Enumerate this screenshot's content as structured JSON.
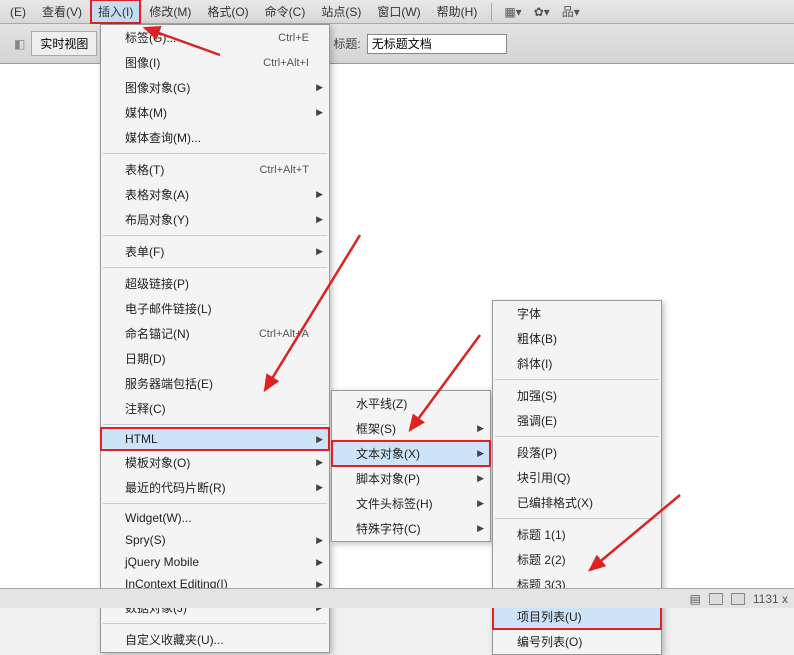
{
  "menubar": {
    "items": [
      {
        "label": "(E)"
      },
      {
        "label": "查看(V)"
      },
      {
        "label": "插入(I)"
      },
      {
        "label": "修改(M)"
      },
      {
        "label": "格式(O)"
      },
      {
        "label": "命令(C)"
      },
      {
        "label": "站点(S)"
      },
      {
        "label": "窗口(W)"
      },
      {
        "label": "帮助(H)"
      }
    ]
  },
  "toolbar": {
    "realtime_btn": "实时视图",
    "title_label": "标题:",
    "title_value": "无标题文档"
  },
  "menu1": {
    "items": [
      {
        "label": "标签(G)...",
        "shortcut": "Ctrl+E"
      },
      {
        "label": "图像(I)",
        "shortcut": "Ctrl+Alt+I"
      },
      {
        "label": "图像对象(G)",
        "arrow": true
      },
      {
        "label": "媒体(M)",
        "arrow": true
      },
      {
        "label": "媒体查询(M)..."
      },
      {
        "sep": true
      },
      {
        "label": "表格(T)",
        "shortcut": "Ctrl+Alt+T"
      },
      {
        "label": "表格对象(A)",
        "arrow": true
      },
      {
        "label": "布局对象(Y)",
        "arrow": true
      },
      {
        "sep": true
      },
      {
        "label": "表单(F)",
        "arrow": true
      },
      {
        "sep": true
      },
      {
        "label": "超级链接(P)"
      },
      {
        "label": "电子邮件链接(L)"
      },
      {
        "label": "命名锚记(N)",
        "shortcut": "Ctrl+Alt+A"
      },
      {
        "label": "日期(D)"
      },
      {
        "label": "服务器端包括(E)"
      },
      {
        "label": "注释(C)"
      },
      {
        "sep": true
      },
      {
        "label": "HTML",
        "arrow": true,
        "redbox": true,
        "hl": true
      },
      {
        "label": "模板对象(O)",
        "arrow": true
      },
      {
        "label": "最近的代码片断(R)",
        "arrow": true
      },
      {
        "sep": true
      },
      {
        "label": "Widget(W)..."
      },
      {
        "label": "Spry(S)",
        "arrow": true
      },
      {
        "label": "jQuery Mobile",
        "arrow": true
      },
      {
        "label": "InContext Editing(I)",
        "arrow": true
      },
      {
        "label": "数据对象(J)",
        "arrow": true
      },
      {
        "sep": true
      },
      {
        "label": "自定义收藏夹(U)..."
      }
    ]
  },
  "menu2": {
    "items": [
      {
        "label": "水平线(Z)"
      },
      {
        "label": "框架(S)",
        "arrow": true
      },
      {
        "label": "文本对象(X)",
        "arrow": true,
        "redbox": true,
        "hl": true
      },
      {
        "label": "脚本对象(P)",
        "arrow": true
      },
      {
        "label": "文件头标签(H)",
        "arrow": true
      },
      {
        "label": "特殊字符(C)",
        "arrow": true
      }
    ]
  },
  "menu3": {
    "items": [
      {
        "label": "字体"
      },
      {
        "label": "粗体(B)"
      },
      {
        "label": "斜体(I)"
      },
      {
        "sep": true
      },
      {
        "label": "加强(S)"
      },
      {
        "label": "强调(E)"
      },
      {
        "sep": true
      },
      {
        "label": "段落(P)"
      },
      {
        "label": "块引用(Q)"
      },
      {
        "label": "已编排格式(X)"
      },
      {
        "sep": true
      },
      {
        "label": "标题 1(1)"
      },
      {
        "label": "标题 2(2)"
      },
      {
        "label": "标题 3(3)"
      },
      {
        "sep": true
      },
      {
        "label": "项目列表(U)",
        "redbox": true,
        "hl": true
      },
      {
        "label": "编号列表(O)"
      }
    ]
  },
  "statusbar": {
    "size": "1131 x"
  }
}
